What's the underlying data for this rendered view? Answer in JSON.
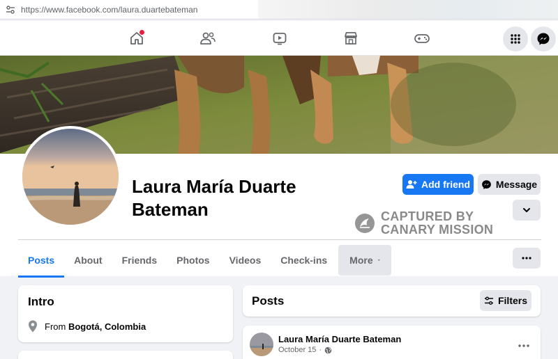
{
  "browser": {
    "url": "https://www.facebook.com/laura.duartebateman"
  },
  "nav": {
    "icons": [
      "home-icon",
      "friends-icon",
      "watch-icon",
      "marketplace-icon",
      "gaming-icon",
      "menu-grid-icon",
      "messenger-icon"
    ],
    "home_has_notification": true
  },
  "profile": {
    "name": "Laura María Duarte Bateman",
    "add_friend_label": "Add friend",
    "message_label": "Message"
  },
  "watermark": {
    "line1": "CAPTURED BY",
    "line2": "CANARY MISSION"
  },
  "tabs": [
    {
      "label": "Posts",
      "active": true
    },
    {
      "label": "About"
    },
    {
      "label": "Friends"
    },
    {
      "label": "Photos"
    },
    {
      "label": "Videos"
    },
    {
      "label": "Check-ins"
    },
    {
      "label": "More"
    }
  ],
  "intro": {
    "title": "Intro",
    "location_prefix": "From",
    "location": "Bogotá, Colombia"
  },
  "posts_section": {
    "title": "Posts",
    "filters_label": "Filters"
  },
  "post": {
    "author": "Laura María Duarte Bateman",
    "date": "October 15",
    "separator": "·"
  },
  "colors": {
    "brand_blue": "#1877f2",
    "notification_red": "#e41e3f",
    "button_grey": "#e4e6eb"
  }
}
